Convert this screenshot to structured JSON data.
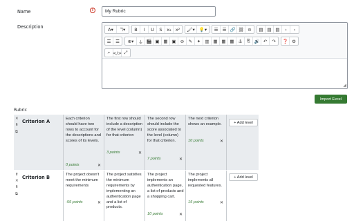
{
  "form": {
    "name_label": "Name",
    "name_value": "My Rubric",
    "required_icon": "!",
    "description_label": "Description"
  },
  "toolbar": {
    "row1": [
      [
        "A▾",
        "ℸ▾"
      ],
      [
        "B",
        "I",
        "U",
        "S",
        "x₂",
        "x²"
      ],
      [
        "🖌▾",
        "💡▾"
      ],
      [
        "☰",
        "☰",
        "🔗",
        "⛓",
        "⊝"
      ],
      [
        "▤",
        "▤",
        "▤",
        "›",
        "‹"
      ]
    ],
    "row2": [
      [
        "☰",
        "☰"
      ],
      [
        "⊕▾",
        "⏚",
        "🎬",
        "▣",
        "▦",
        "▣",
        "⊘",
        "✎",
        "✦",
        "▥",
        "▦",
        "▦",
        "▦",
        "⚓",
        "⎘",
        "🔊",
        "↶",
        "↷"
      ],
      [
        "❓",
        "⚙"
      ]
    ],
    "row3": [
      "⌕",
      "</>",
      "⤢"
    ]
  },
  "import_button": "Import Excel",
  "rubric_label": "Rubric",
  "add_level_label": "+ Add level",
  "delete_glyph": "✕",
  "criteria": [
    {
      "description": "Criterion A",
      "levels": [
        {
          "text": "Each criterion should have two rows to account for the descriptions and scores of its levels.",
          "score": "0 points"
        },
        {
          "text": "The first row should include a description of the level (column) for that criterion",
          "score": "3 points"
        },
        {
          "text": "The second row should include the score associated to the level (column) for that criterion.",
          "score": "7 points"
        },
        {
          "text": "The next criterion shows an example.",
          "score": "10 points"
        }
      ]
    },
    {
      "description": "Criterion B",
      "levels": [
        {
          "text": "The project doesn't meet the minimum requirements",
          "score": "-55 points"
        },
        {
          "text": "The project satisfies the minimum requirements by implementing an authentication page and a list of products.",
          "score": "5 points"
        },
        {
          "text": "The project implements an authentication page, a list of products and a shopping cart.",
          "score": "10 points"
        },
        {
          "text": "The project implements all requested features.",
          "score": "15 points"
        }
      ]
    }
  ]
}
